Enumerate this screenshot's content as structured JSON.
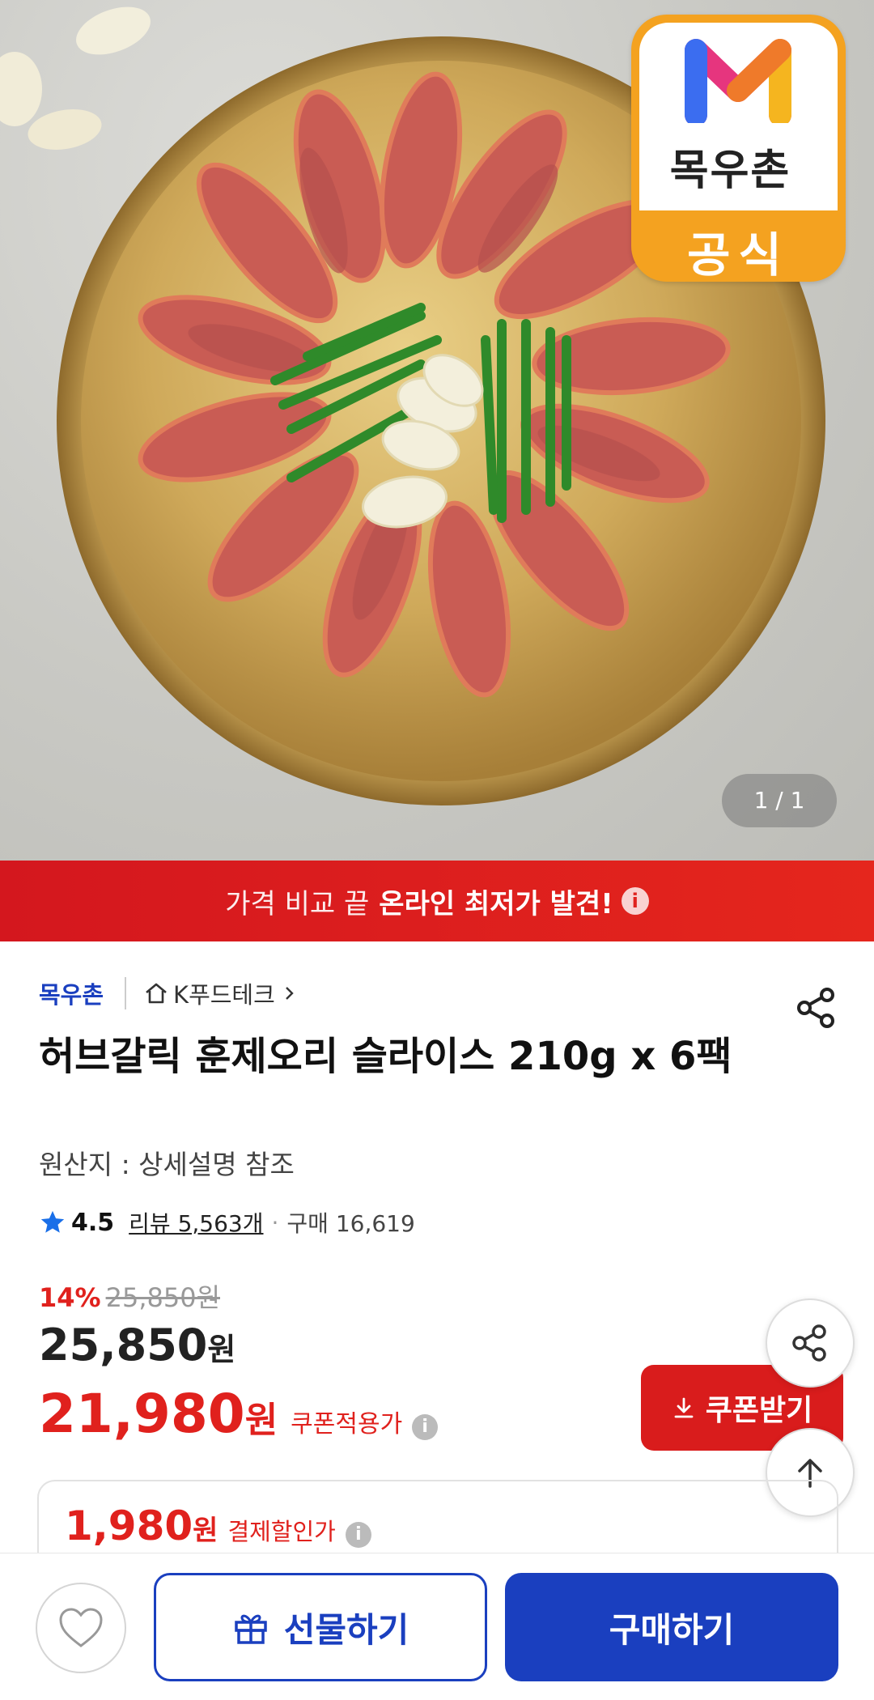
{
  "hero": {
    "badge_brand": "목우촌",
    "badge_official": "공식",
    "counter": "1 / 1"
  },
  "banner": {
    "normal_text": "가격 비교 끝",
    "strong_text": "온라인 최저가 발견!",
    "info_icon": "i"
  },
  "product": {
    "brand": "목우촌",
    "store": "K푸드테크",
    "title": "허브갈릭 훈제오리 슬라이스 210g x 6팩",
    "origin": "원산지 : 상세설명 참조",
    "rating": "4.5",
    "reviews": "리뷰 5,563개",
    "separator": "·",
    "purchases": "구매 16,619"
  },
  "price": {
    "discount_pct": "14%",
    "original": "25,850원",
    "main_amount": "25,850",
    "main_won": "원",
    "coupon_amount": "21,980",
    "coupon_won": "원",
    "coupon_label": "쿠폰적용가",
    "coupon_button": "쿠폰받기",
    "pay_amount": "1,980",
    "pay_won": "원",
    "pay_label": "결제할인가"
  },
  "bottom": {
    "gift_label": "선물하기",
    "buy_label": "구매하기"
  },
  "colors": {
    "brand_blue": "#1a3fbf",
    "accent_red": "#e0211d",
    "badge_orange": "#f4a220"
  },
  "icons": [
    "share-icon",
    "home-icon",
    "chevron-right-icon",
    "star-icon",
    "download-icon",
    "arrow-up-icon",
    "heart-icon",
    "gift-icon",
    "info-icon"
  ]
}
